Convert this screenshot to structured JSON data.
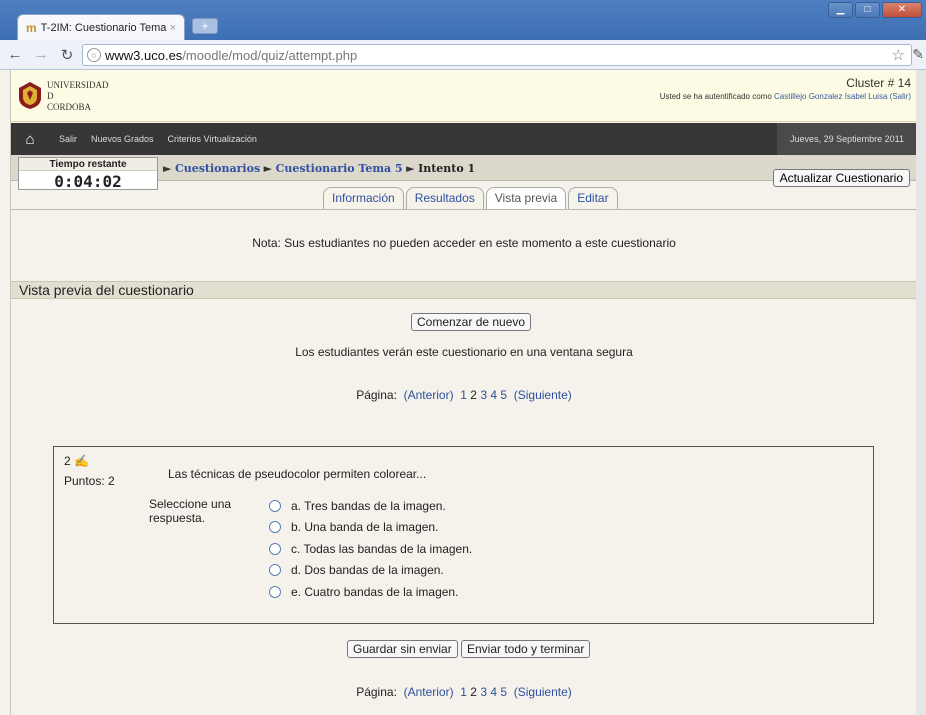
{
  "browser": {
    "tab_title": "T-2IM: Cuestionario Tema 5",
    "tab_close": "×",
    "new_tab": "+",
    "url_host": "www3.uco.es",
    "url_path": "/moodle/mod/quiz/attempt.php"
  },
  "header": {
    "logo_line1": "UNIVERSIDAD",
    "logo_line2": "D",
    "logo_line3": "CORDOBA",
    "cluster": "Cluster # 14",
    "auth_prefix": "Usted se ha autentificado como",
    "auth_user": "Castillejo Gonzalez Isabel Luisa",
    "auth_logout": "(Salir)"
  },
  "nav": {
    "items": [
      "Salir",
      "Nuevos Grados",
      "Criterios Virtualización"
    ],
    "date": "Jueves, 29 Septiembre 2011"
  },
  "timer": {
    "label": "Tiempo restante",
    "value": "0:04:02"
  },
  "breadcrumb": {
    "item1": "Cuestionarios",
    "item2": "Cuestionario Tema 5",
    "current": "Intento 1"
  },
  "update_button": "Actualizar Cuestionario",
  "tabs": [
    "Información",
    "Resultados",
    "Vista previa",
    "Editar"
  ],
  "note": "Nota: Sus estudiantes no pueden acceder en este momento a este cuestionario",
  "section_title": "Vista previa del cuestionario",
  "restart_button": "Comenzar de nuevo",
  "secure_note": "Los estudiantes verán este cuestionario en una ventana segura",
  "pager": {
    "label": "Página:",
    "prev": "(Anterior)",
    "pages": [
      "1",
      "2",
      "3",
      "4",
      "5"
    ],
    "next": "(Siguiente)"
  },
  "question": {
    "number": "2",
    "points": "Puntos: 2",
    "text": "Las técnicas de pseudocolor permiten colorear...",
    "prompt": "Seleccione una respuesta.",
    "answers": [
      "a. Tres bandas de la imagen.",
      "b. Una banda de la imagen.",
      "c. Todas las bandas de la imagen.",
      "d. Dos bandas de la imagen.",
      "e. Cuatro bandas de la imagen."
    ]
  },
  "actions": {
    "save": "Guardar sin enviar",
    "finish": "Enviar todo y terminar"
  }
}
